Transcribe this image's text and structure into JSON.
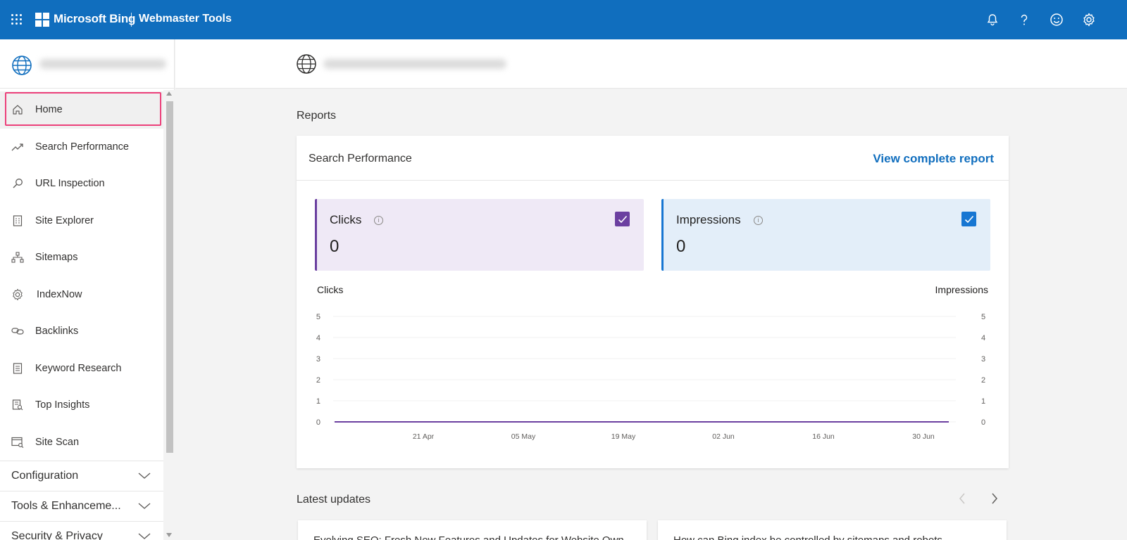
{
  "topbar": {
    "brand": "Microsoft Bing",
    "product": "Webmaster Tools",
    "icons": [
      "apps-waffle-icon",
      "notification-bell-icon",
      "help-icon",
      "feedback-smiley-icon",
      "settings-gear-icon"
    ],
    "background": "#106ebe"
  },
  "sidebar": {
    "items": [
      {
        "label": "Home",
        "icon": "home-icon",
        "active": true
      },
      {
        "label": "Search Performance",
        "icon": "trend-icon"
      },
      {
        "label": "URL Inspection",
        "icon": "search-icon"
      },
      {
        "label": "Site Explorer",
        "icon": "document-icon"
      },
      {
        "label": "Sitemaps",
        "icon": "sitemap-icon"
      },
      {
        "label": "IndexNow",
        "icon": "gear-icon"
      },
      {
        "label": "Backlinks",
        "icon": "link-icon"
      },
      {
        "label": "Keyword Research",
        "icon": "list-icon"
      },
      {
        "label": "Top Insights",
        "icon": "insights-icon"
      },
      {
        "label": "Site Scan",
        "icon": "scan-icon"
      }
    ],
    "sections": [
      {
        "label": "Configuration"
      },
      {
        "label": "Tools & Enhanceme..."
      },
      {
        "label": "Security & Privacy"
      }
    ],
    "highlight_color": "#ec407a"
  },
  "main": {
    "reports_title": "Reports",
    "card": {
      "title": "Search Performance",
      "link": "View complete report",
      "metrics": {
        "clicks": {
          "label": "Clicks",
          "value": "0",
          "checked": true,
          "color": "#6b3fa0"
        },
        "impressions": {
          "label": "Impressions",
          "value": "0",
          "checked": true,
          "color": "#1776d2"
        }
      }
    },
    "latest_updates_title": "Latest updates",
    "updates": [
      {
        "title": "Evolving SEO: Fresh New Features and Updates for Website Own..."
      },
      {
        "title": "How can Bing index be controlled by sitemaps and robots..."
      }
    ]
  },
  "chart_data": {
    "type": "line",
    "xlabel": "",
    "ylabel": "Clicks",
    "y2label": "Impressions",
    "ylim": [
      0,
      5
    ],
    "y2lim": [
      0,
      5
    ],
    "yticks": [
      0,
      1,
      2,
      3,
      4,
      5
    ],
    "y2ticks": [
      0,
      1,
      2,
      3,
      4,
      5
    ],
    "x_ticks": [
      "21 Apr",
      "05 May",
      "19 May",
      "02 Jun",
      "16 Jun",
      "30 Jun"
    ],
    "series": [
      {
        "name": "Clicks",
        "color": "#6b3fa0",
        "values": [
          0,
          0,
          0,
          0,
          0,
          0
        ]
      },
      {
        "name": "Impressions",
        "color": "#1776d2",
        "values": [
          0,
          0,
          0,
          0,
          0,
          0
        ]
      }
    ],
    "grid": true
  }
}
